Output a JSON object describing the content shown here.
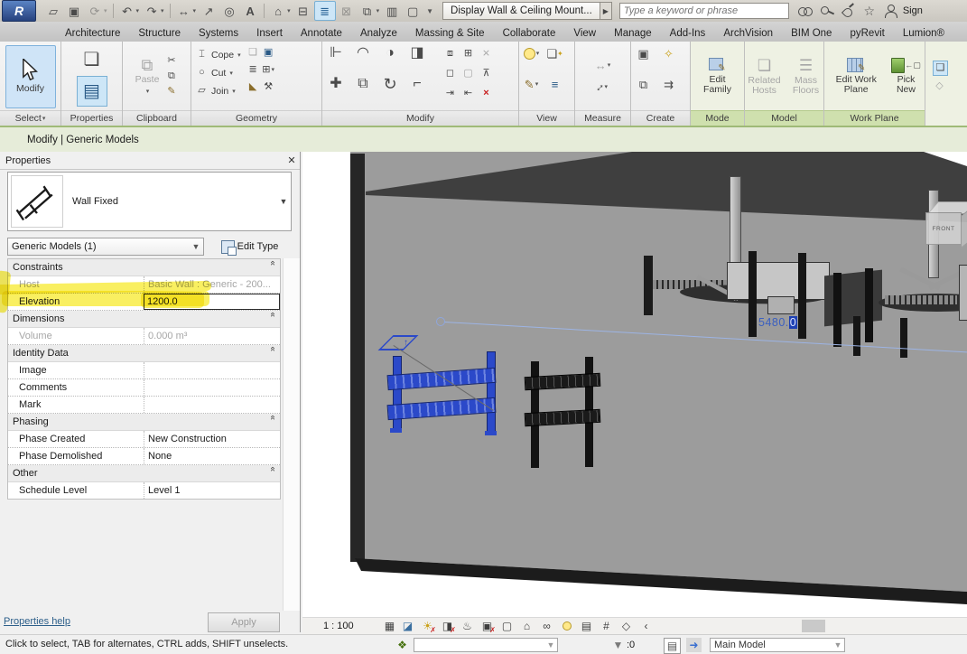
{
  "titlebar": {
    "title": "Display Wall & Ceiling Mount...",
    "search_placeholder": "Type a keyword or phrase",
    "signin_label": "Sign"
  },
  "tabs": [
    "Architecture",
    "Structure",
    "Systems",
    "Insert",
    "Annotate",
    "Analyze",
    "Massing & Site",
    "Collaborate",
    "View",
    "Manage",
    "Add-Ins",
    "ArchVision",
    "BIM One",
    "pyRevit",
    "Lumion®"
  ],
  "ribbon": {
    "select_label": "Select",
    "modify_button": "Modify",
    "panels": {
      "properties": "Properties",
      "clipboard": "Clipboard",
      "geometry": "Geometry",
      "modify": "Modify",
      "view": "View",
      "measure": "Measure",
      "create": "Create",
      "mode": "Mode",
      "model": "Model",
      "workplane": "Work Plane"
    },
    "paste_label": "Paste",
    "geometry_items": [
      "Cope",
      "Cut",
      "Join"
    ],
    "edit_family": "Edit Family",
    "related_hosts": "Related Hosts",
    "mass_floors": "Mass Floors",
    "edit_work_plane": "Edit Work Plane",
    "pick_new": "Pick New"
  },
  "modebar": {
    "label": "Modify | Generic Models"
  },
  "properties_palette": {
    "title": "Properties",
    "type_name": "Wall Fixed",
    "category_selector": "Generic Models (1)",
    "edit_type_label": "Edit Type",
    "groups": [
      {
        "name": "Constraints",
        "rows": [
          {
            "label": "Host",
            "value": "Basic Wall : Generic - 200...",
            "disabled": true
          },
          {
            "label": "Elevation",
            "value": "1200.0",
            "highlighted": true
          }
        ]
      },
      {
        "name": "Dimensions",
        "rows": [
          {
            "label": "Volume",
            "value": "0.000 m³",
            "disabled": true
          }
        ]
      },
      {
        "name": "Identity Data",
        "rows": [
          {
            "label": "Image",
            "value": ""
          },
          {
            "label": "Comments",
            "value": ""
          },
          {
            "label": "Mark",
            "value": ""
          }
        ]
      },
      {
        "name": "Phasing",
        "rows": [
          {
            "label": "Phase Created",
            "value": "New Construction"
          },
          {
            "label": "Phase Demolished",
            "value": "None"
          }
        ]
      },
      {
        "name": "Other",
        "rows": [
          {
            "label": "Schedule Level",
            "value": "Level 1"
          }
        ]
      }
    ],
    "help_link": "Properties help",
    "apply_label": "Apply"
  },
  "viewport": {
    "temp_dimension": "5480.",
    "temp_dimension_selected": "0",
    "viewcube_front": "FRONT"
  },
  "view_control_bar": {
    "scale": "1 : 100"
  },
  "statusbar": {
    "hint": "Click to select, TAB for alternates, CTRL adds, SHIFT unselects.",
    "filter_count": ":0",
    "design_option": "Main Model"
  },
  "colors": {
    "selection_blue": "#2b49c9",
    "highlight_yellow": "#f6e70c",
    "contextual_green": "#cfe0ae",
    "temp_dim_blue": "#3a5fc0"
  }
}
